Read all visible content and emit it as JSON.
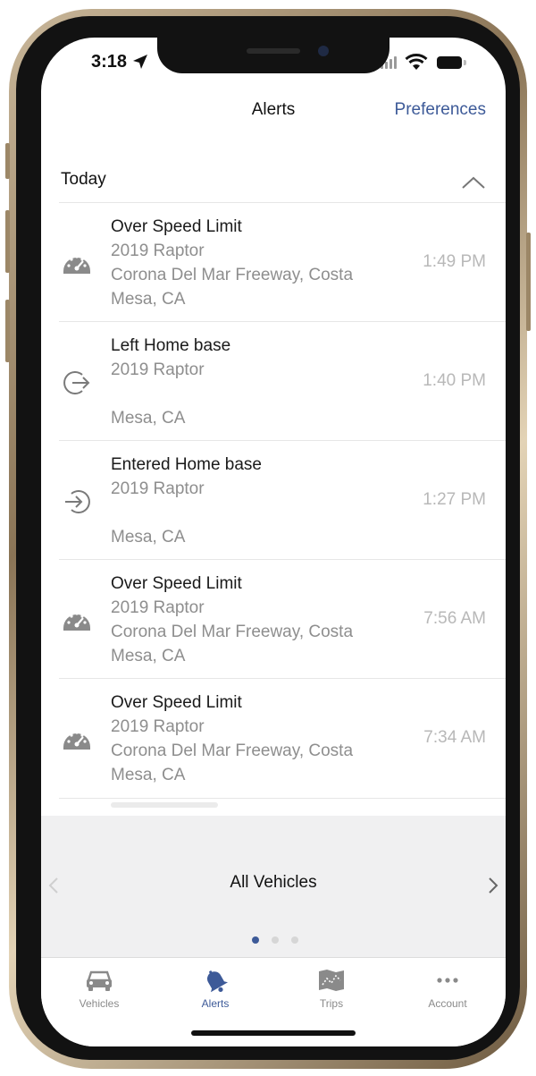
{
  "status_bar": {
    "time": "3:18"
  },
  "header": {
    "title": "Alerts",
    "preferences_label": "Preferences"
  },
  "section": {
    "title": "Today"
  },
  "alerts": [
    {
      "title": "Over Speed Limit",
      "vehicle": "2019 Raptor",
      "location_line1": "Corona Del Mar Freeway, Costa",
      "location_line2": "Mesa, CA",
      "time": "1:49 PM",
      "icon": "speedometer-icon"
    },
    {
      "title": "Left Home base",
      "vehicle": "2019 Raptor",
      "location_line1": "",
      "location_line2": "Mesa, CA",
      "time": "1:40 PM",
      "icon": "exit-icon"
    },
    {
      "title": "Entered Home base",
      "vehicle": "2019 Raptor",
      "location_line1": "",
      "location_line2": "Mesa, CA",
      "time": "1:27 PM",
      "icon": "enter-icon"
    },
    {
      "title": "Over Speed Limit",
      "vehicle": "2019 Raptor",
      "location_line1": "Corona Del Mar Freeway, Costa",
      "location_line2": "Mesa, CA",
      "time": "7:56 AM",
      "icon": "speedometer-icon"
    },
    {
      "title": "Over Speed Limit",
      "vehicle": "2019 Raptor",
      "location_line1": "Corona Del Mar Freeway, Costa",
      "location_line2": "Mesa, CA",
      "time": "7:34 AM",
      "icon": "speedometer-icon"
    }
  ],
  "vehicle_selector": {
    "label": "All Vehicles",
    "page_count": 3,
    "active_page": 1
  },
  "tab_bar": {
    "tabs": [
      {
        "label": "Vehicles",
        "icon": "car-icon",
        "active": false
      },
      {
        "label": "Alerts",
        "icon": "bell-icon",
        "active": true
      },
      {
        "label": "Trips",
        "icon": "map-icon",
        "active": false
      },
      {
        "label": "Account",
        "icon": "more-icon",
        "active": false
      }
    ]
  },
  "colors": {
    "accent": "#3d5a98",
    "muted_text": "#8e8e8e",
    "time_text": "#b8b8b8",
    "icon_gray": "#8a8a8a",
    "panel_bg": "#f0f0f1"
  }
}
